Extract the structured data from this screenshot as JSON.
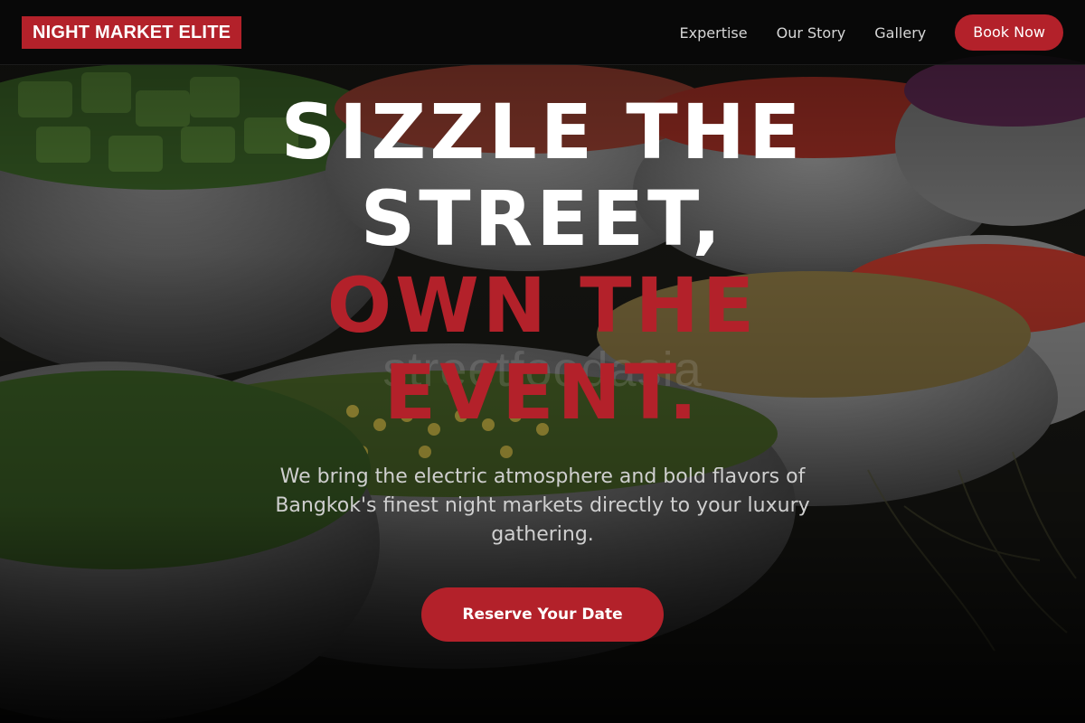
{
  "nav": {
    "logo": "NIGHT MARKET ELITE",
    "links": [
      "Expertise",
      "Our Story",
      "Gallery"
    ],
    "book_label": "Book Now"
  },
  "hero": {
    "headline_white": [
      "SIZZLE THE",
      "STREET,"
    ],
    "headline_red": [
      "OWN THE",
      "EVENT."
    ],
    "watermark": "streetfoodasia",
    "subhead": "We bring the electric atmosphere and bold flavors of Bangkok's finest night markets directly to your luxury gathering.",
    "cta_label": "Reserve Your Date"
  },
  "colors": {
    "accent": "#b3212a",
    "nav_bg": "#080808",
    "text_muted": "#cfcfcf"
  }
}
